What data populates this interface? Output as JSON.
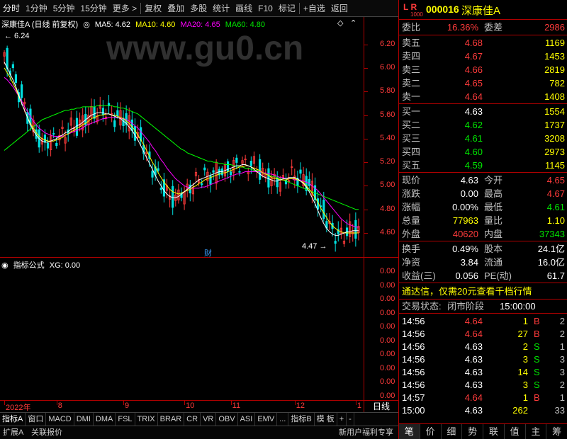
{
  "toolbar": {
    "items": [
      "分时",
      "1分钟",
      "5分钟",
      "15分钟",
      "更多 >",
      "复权",
      "叠加",
      "多股",
      "统计",
      "画线",
      "F10",
      "标记",
      "+自选",
      "返回"
    ]
  },
  "main_chart": {
    "title": "深康佳A (日线 前复权)",
    "ma5": "MA5: 4.62",
    "ma10": "MA10: 4.60",
    "ma20": "MA20: 4.65",
    "ma60": "MA60: 4.80",
    "high_label": "6.24",
    "low_label": "4.47",
    "cai_marker": "财",
    "watermark": "www.gu0.cn",
    "colors": {
      "up": "#ff3b3b",
      "down": "#00e0e0",
      "ma5": "#ffffff",
      "ma10": "#ffff00",
      "ma20": "#ff00ff",
      "ma60": "#00ff00"
    }
  },
  "sub_chart": {
    "title": "指标公式",
    "xg": "XG: 0.00"
  },
  "chart_data": {
    "type": "candlestick",
    "y_axis": [
      "6.20",
      "6.00",
      "5.80",
      "5.60",
      "5.40",
      "5.20",
      "5.00",
      "4.80",
      "4.60"
    ],
    "ylim": [
      4.45,
      6.3
    ],
    "sub_axis": [
      "0.00",
      "0.00",
      "0.00",
      "0.00",
      "0.00",
      "0.00",
      "0.00",
      "0.00",
      "0.00",
      "0.00"
    ],
    "x_ticks": [
      {
        "label": "2022年",
        "index": 0
      },
      {
        "label": "8",
        "index": 18
      },
      {
        "label": "9",
        "index": 41
      },
      {
        "label": "10",
        "index": 62
      },
      {
        "label": "11",
        "index": 78
      },
      {
        "label": "12",
        "index": 100
      },
      {
        "label": "1",
        "index": 121
      }
    ],
    "close": [
      6.1,
      6.02,
      5.98,
      5.93,
      5.86,
      5.79,
      5.72,
      5.66,
      5.6,
      5.53,
      5.47,
      5.42,
      5.39,
      5.37,
      5.36,
      5.37,
      5.38,
      5.4,
      5.41,
      5.43,
      5.44,
      5.46,
      5.47,
      5.49,
      5.5,
      5.51,
      5.53,
      5.55,
      5.57,
      5.59,
      5.61,
      5.62,
      5.63,
      5.63,
      5.62,
      5.62,
      5.61,
      5.6,
      5.59,
      5.58,
      5.57,
      5.56,
      5.54,
      5.52,
      5.49,
      5.45,
      5.41,
      5.36,
      5.31,
      5.25,
      5.2,
      5.15,
      5.1,
      5.05,
      5.0,
      4.96,
      4.93,
      4.91,
      4.9,
      4.9,
      4.91,
      4.93,
      4.95,
      4.97,
      4.99,
      5.02,
      5.04,
      5.06,
      5.07,
      5.08,
      5.09,
      5.1,
      5.11,
      5.12,
      5.12,
      5.13,
      5.13,
      5.14,
      5.15,
      5.16,
      5.17,
      5.18,
      5.19,
      5.19,
      5.19,
      5.18,
      5.16,
      5.14,
      5.12,
      5.1,
      5.08,
      5.06,
      5.05,
      5.04,
      5.04,
      5.04,
      5.05,
      5.06,
      5.07,
      5.08,
      5.08,
      5.08,
      5.07,
      5.05,
      5.03,
      5.0,
      4.96,
      4.91,
      4.85,
      4.79,
      4.73,
      4.68,
      4.64,
      4.61,
      4.59,
      4.58,
      4.58,
      4.59,
      4.6,
      4.61,
      4.62,
      4.63,
      4.63
    ],
    "ma5": [
      6.05,
      6.0,
      5.95,
      5.9,
      5.84,
      5.77,
      5.7,
      5.64,
      5.58,
      5.52,
      5.47,
      5.43,
      5.4,
      5.38,
      5.37,
      5.37,
      5.38,
      5.39,
      5.4,
      5.42,
      5.43,
      5.45,
      5.46,
      5.48,
      5.49,
      5.51,
      5.52,
      5.54,
      5.56,
      5.58,
      5.6,
      5.61,
      5.62,
      5.62,
      5.62,
      5.61,
      5.61,
      5.6,
      5.59,
      5.58,
      5.57,
      5.55,
      5.53,
      5.5,
      5.47,
      5.43,
      5.39,
      5.34,
      5.29,
      5.24,
      5.19,
      5.14,
      5.09,
      5.04,
      5.0,
      4.96,
      4.93,
      4.91,
      4.9,
      4.9,
      4.91,
      4.93,
      4.95,
      4.97,
      4.99,
      5.01,
      5.03,
      5.05,
      5.06,
      5.07,
      5.08,
      5.09,
      5.1,
      5.11,
      5.12,
      5.12,
      5.13,
      5.14,
      5.15,
      5.16,
      5.17,
      5.17,
      5.18,
      5.18,
      5.17,
      5.16,
      5.14,
      5.12,
      5.1,
      5.08,
      5.07,
      5.06,
      5.05,
      5.04,
      5.04,
      5.05,
      5.06,
      5.06,
      5.07,
      5.07,
      5.07,
      5.06,
      5.04,
      5.02,
      4.99,
      4.95,
      4.9,
      4.85,
      4.79,
      4.73,
      4.68,
      4.64,
      4.61,
      4.59,
      4.58,
      4.58,
      4.59,
      4.6,
      4.61,
      4.61,
      4.62,
      4.62,
      4.62
    ],
    "ma10": [
      6.0,
      5.96,
      5.92,
      5.87,
      5.82,
      5.76,
      5.7,
      5.64,
      5.58,
      5.53,
      5.49,
      5.45,
      5.42,
      5.4,
      5.39,
      5.38,
      5.38,
      5.38,
      5.39,
      5.4,
      5.41,
      5.43,
      5.44,
      5.46,
      5.47,
      5.49,
      5.5,
      5.52,
      5.53,
      5.55,
      5.57,
      5.58,
      5.59,
      5.6,
      5.6,
      5.61,
      5.61,
      5.6,
      5.6,
      5.59,
      5.58,
      5.57,
      5.55,
      5.53,
      5.5,
      5.47,
      5.43,
      5.39,
      5.35,
      5.3,
      5.25,
      5.2,
      5.16,
      5.11,
      5.07,
      5.03,
      5.0,
      4.97,
      4.95,
      4.94,
      4.93,
      4.94,
      4.95,
      4.96,
      4.97,
      4.99,
      5.0,
      5.02,
      5.03,
      5.05,
      5.06,
      5.07,
      5.08,
      5.09,
      5.1,
      5.11,
      5.11,
      5.12,
      5.13,
      5.14,
      5.15,
      5.16,
      5.16,
      5.17,
      5.17,
      5.16,
      5.15,
      5.14,
      5.13,
      5.11,
      5.1,
      5.09,
      5.07,
      5.06,
      5.06,
      5.05,
      5.05,
      5.05,
      5.06,
      5.06,
      5.06,
      5.05,
      5.04,
      5.03,
      5.0,
      4.97,
      4.94,
      4.9,
      4.86,
      4.81,
      4.77,
      4.73,
      4.69,
      4.66,
      4.64,
      4.62,
      4.61,
      4.6,
      4.6,
      4.6,
      4.6,
      4.6,
      4.6
    ],
    "ma20": [
      5.92,
      5.9,
      5.87,
      5.84,
      5.8,
      5.76,
      5.72,
      5.67,
      5.63,
      5.59,
      5.55,
      5.52,
      5.49,
      5.47,
      5.45,
      5.44,
      5.43,
      5.42,
      5.42,
      5.42,
      5.42,
      5.43,
      5.44,
      5.45,
      5.46,
      5.47,
      5.48,
      5.49,
      5.51,
      5.52,
      5.53,
      5.54,
      5.55,
      5.56,
      5.57,
      5.57,
      5.58,
      5.58,
      5.58,
      5.58,
      5.57,
      5.57,
      5.56,
      5.55,
      5.53,
      5.51,
      5.49,
      5.46,
      5.43,
      5.4,
      5.37,
      5.33,
      5.3,
      5.26,
      5.22,
      5.19,
      5.15,
      5.12,
      5.09,
      5.06,
      5.04,
      5.02,
      5.0,
      4.99,
      4.98,
      4.98,
      4.98,
      4.98,
      4.99,
      4.99,
      5.0,
      5.01,
      5.02,
      5.03,
      5.04,
      5.05,
      5.06,
      5.07,
      5.08,
      5.09,
      5.1,
      5.1,
      5.11,
      5.12,
      5.12,
      5.12,
      5.12,
      5.12,
      5.12,
      5.11,
      5.11,
      5.1,
      5.1,
      5.09,
      5.08,
      5.07,
      5.07,
      5.06,
      5.06,
      5.06,
      5.05,
      5.05,
      5.05,
      5.04,
      5.03,
      5.02,
      5.0,
      4.98,
      4.96,
      4.93,
      4.9,
      4.87,
      4.84,
      4.81,
      4.78,
      4.75,
      4.72,
      4.7,
      4.68,
      4.67,
      4.66,
      4.65,
      4.65
    ],
    "ma60": [
      5.3,
      5.32,
      5.34,
      5.36,
      5.38,
      5.4,
      5.42,
      5.44,
      5.46,
      5.48,
      5.5,
      5.52,
      5.54,
      5.56,
      5.57,
      5.58,
      5.59,
      5.6,
      5.61,
      5.62,
      5.63,
      5.64,
      5.64,
      5.65,
      5.65,
      5.66,
      5.66,
      5.67,
      5.67,
      5.67,
      5.67,
      5.67,
      5.68,
      5.68,
      5.68,
      5.68,
      5.68,
      5.68,
      5.67,
      5.67,
      5.66,
      5.66,
      5.65,
      5.64,
      5.63,
      5.62,
      5.61,
      5.59,
      5.57,
      5.55,
      5.53,
      5.51,
      5.49,
      5.47,
      5.45,
      5.43,
      5.41,
      5.39,
      5.37,
      5.35,
      5.33,
      5.31,
      5.3,
      5.28,
      5.27,
      5.26,
      5.25,
      5.24,
      5.23,
      5.22,
      5.21,
      5.21,
      5.2,
      5.2,
      5.19,
      5.19,
      5.18,
      5.18,
      5.18,
      5.17,
      5.17,
      5.16,
      5.16,
      5.15,
      5.15,
      5.14,
      5.13,
      5.13,
      5.12,
      5.11,
      5.1,
      5.09,
      5.08,
      5.08,
      5.07,
      5.06,
      5.05,
      5.04,
      5.03,
      5.02,
      5.01,
      5.0,
      4.99,
      4.98,
      4.97,
      4.96,
      4.95,
      4.94,
      4.93,
      4.92,
      4.91,
      4.9,
      4.89,
      4.88,
      4.87,
      4.86,
      4.85,
      4.84,
      4.83,
      4.82,
      4.81,
      4.8,
      4.8
    ]
  },
  "bottom_tabs": [
    "指标A",
    "窗口",
    "MACD",
    "DMI",
    "DMA",
    "FSL",
    "TRIX",
    "BRAR",
    "CR",
    "VR",
    "OBV",
    "ASI",
    "EMV",
    "...",
    "指标B",
    "模 板",
    "+",
    "-"
  ],
  "period_label": "日线",
  "bottom_bar": {
    "left1": "扩展A",
    "left2": "关联报价",
    "right": "新用户福利专享"
  },
  "quote": {
    "badge_top": "L R",
    "badge_sub": "1000",
    "code": "000016",
    "name": "深康佳A",
    "weibi_label": "委比",
    "weibi": "16.36%",
    "weicha_label": "委差",
    "weicha": "2986",
    "sell": [
      {
        "label": "卖五",
        "price": "4.68",
        "vol": "1169"
      },
      {
        "label": "卖四",
        "price": "4.67",
        "vol": "1453"
      },
      {
        "label": "卖三",
        "price": "4.66",
        "vol": "2819"
      },
      {
        "label": "卖二",
        "price": "4.65",
        "vol": "782"
      },
      {
        "label": "卖一",
        "price": "4.64",
        "vol": "1408"
      }
    ],
    "buy": [
      {
        "label": "买一",
        "price": "4.63",
        "vol": "1554"
      },
      {
        "label": "买二",
        "price": "4.62",
        "vol": "1737"
      },
      {
        "label": "买三",
        "price": "4.61",
        "vol": "3208"
      },
      {
        "label": "买四",
        "price": "4.60",
        "vol": "2973"
      },
      {
        "label": "买五",
        "price": "4.59",
        "vol": "1145"
      }
    ],
    "stats": [
      {
        "l1": "现价",
        "v1": "4.63",
        "l2": "今开",
        "v2": "4.65"
      },
      {
        "l1": "涨跌",
        "v1": "0.00",
        "l2": "最高",
        "v2": "4.67"
      },
      {
        "l1": "涨幅",
        "v1": "0.00%",
        "l2": "最低",
        "v2": "4.61"
      },
      {
        "l1": "总量",
        "v1": "77963",
        "l2": "量比",
        "v2": "1.10"
      },
      {
        "l1": "外盘",
        "v1": "40620",
        "l2": "内盘",
        "v2": "37343"
      }
    ],
    "fund": [
      {
        "l1": "换手",
        "v1": "0.49%",
        "l2": "股本",
        "v2": "24.1亿"
      },
      {
        "l1": "净资",
        "v1": "3.84",
        "l2": "流通",
        "v2": "16.0亿"
      },
      {
        "l1": "收益(三)",
        "v1": "0.056",
        "l2": "PE(动)",
        "v2": "61.7"
      }
    ],
    "promo": "通达信，仅需20元查看千档行情",
    "status_label": "交易状态:",
    "status_value": "闭市阶段",
    "status_time": "15:00:00",
    "trades": [
      {
        "time": "14:56",
        "price": "4.64",
        "vol": "1",
        "bs": "B",
        "n": "2"
      },
      {
        "time": "14:56",
        "price": "4.64",
        "vol": "27",
        "bs": "B",
        "n": "2"
      },
      {
        "time": "14:56",
        "price": "4.63",
        "vol": "2",
        "bs": "S",
        "n": "1"
      },
      {
        "time": "14:56",
        "price": "4.63",
        "vol": "3",
        "bs": "S",
        "n": "3"
      },
      {
        "time": "14:56",
        "price": "4.63",
        "vol": "14",
        "bs": "S",
        "n": "3"
      },
      {
        "time": "14:56",
        "price": "4.63",
        "vol": "3",
        "bs": "S",
        "n": "2"
      },
      {
        "time": "14:57",
        "price": "4.64",
        "vol": "1",
        "bs": "B",
        "n": "1"
      },
      {
        "time": "15:00",
        "price": "4.63",
        "vol": "262",
        "bs": "",
        "n": "33"
      }
    ],
    "bottom_tabs": [
      "笔",
      "价",
      "细",
      "势",
      "联",
      "值",
      "主",
      "筹"
    ]
  }
}
